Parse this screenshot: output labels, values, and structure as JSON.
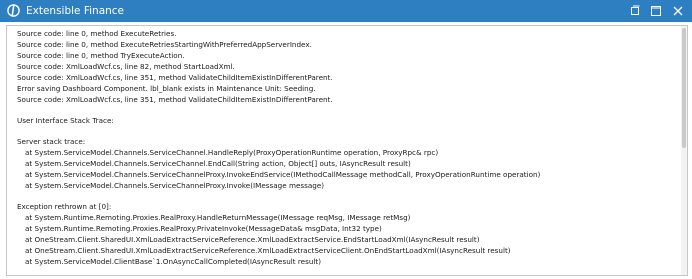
{
  "window": {
    "title": "Extensible Finance",
    "accent_color": "#2e7fc2",
    "icons": [
      "app-logo-icon",
      "restore-icon",
      "maximize-icon",
      "close-icon"
    ]
  },
  "log": {
    "lines": [
      "Source code: line 0, method ExecuteRetries.",
      "Source code: line 0, method ExecuteRetriesStartingWithPreferredAppServerIndex.",
      "Source code: line 0, method TryExecuteAction.",
      "Source code: XmlLoadWcf.cs, line 82, method StartLoadXml.",
      "Source code: XmlLoadWcf.cs, line 351, method ValidateChildItemExistInDifferentParent.",
      "Error saving Dashboard Component. lbl_blank exists in Maintenance Unit: Seeding.",
      "Source code: XmlLoadWcf.cs, line 351, method ValidateChildItemExistInDifferentParent.",
      "",
      "User Interface Stack Trace:",
      "",
      "Server stack trace:",
      "at System.ServiceModel.Channels.ServiceChannel.HandleReply(ProxyOperationRuntime operation, ProxyRpc& rpc)",
      "at System.ServiceModel.Channels.ServiceChannel.EndCall(String action, Object[] outs, IAsyncResult result)",
      "at System.ServiceModel.Channels.ServiceChannelProxy.InvokeEndService(IMethodCallMessage methodCall, ProxyOperationRuntime operation)",
      "at System.ServiceModel.Channels.ServiceChannelProxy.Invoke(IMessage message)",
      "",
      "Exception rethrown at [0]:",
      "at System.Runtime.Remoting.Proxies.RealProxy.HandleReturnMessage(IMessage reqMsg, IMessage retMsg)",
      "at System.Runtime.Remoting.Proxies.RealProxy.PrivateInvoke(MessageData& msgData, Int32 type)",
      "at OneStream.Client.SharedUI.XmlLoadExtractServiceReference.XmlLoadExtractService.EndStartLoadXml(IAsyncResult result)",
      "at OneStream.Client.SharedUI.XmlLoadExtractServiceReference.XmlLoadExtractServiceClient.OnEndStartLoadXml(IAsyncResult result)",
      "at System.ServiceModel.ClientBase`1.OnAsyncCallCompleted(IAsyncResult result)"
    ]
  }
}
